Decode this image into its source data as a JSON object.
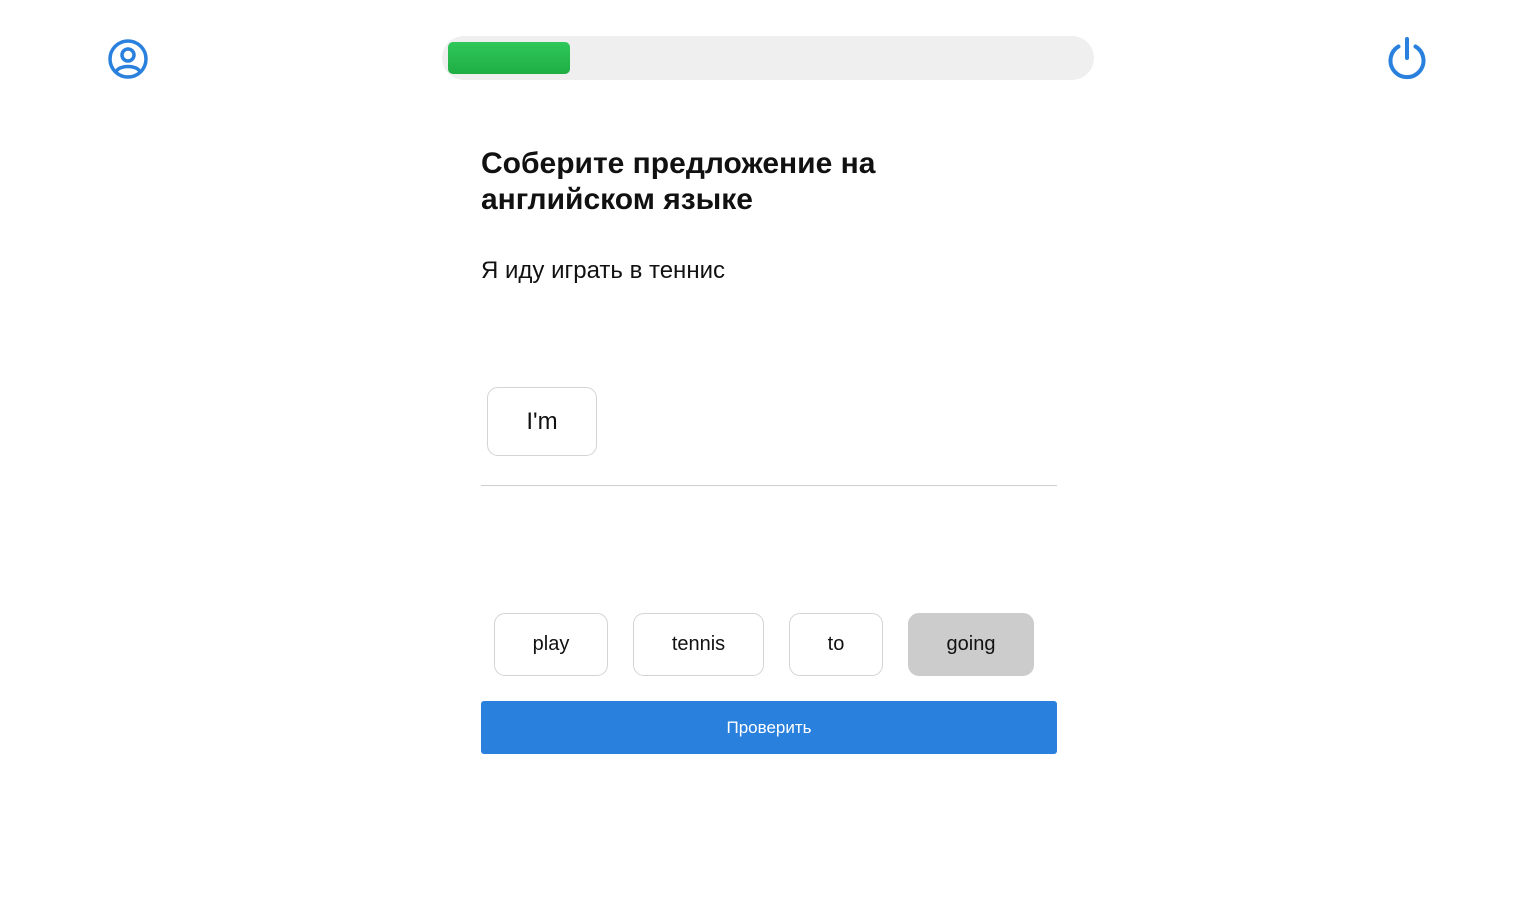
{
  "header": {
    "profile_icon": "user-circle-icon",
    "power_icon": "power-icon",
    "progress": 0.19,
    "progress_color": "#22bb4e",
    "accent_color": "#2980dd"
  },
  "task": {
    "title": "Соберите предложение на английском языке",
    "source_sentence": "Я иду играть в теннис"
  },
  "answer": {
    "words": [
      "I'm"
    ]
  },
  "word_bank": {
    "words": [
      "play",
      "tennis",
      "to",
      "going"
    ],
    "used": [
      "going"
    ]
  },
  "actions": {
    "check_label": "Проверить"
  }
}
